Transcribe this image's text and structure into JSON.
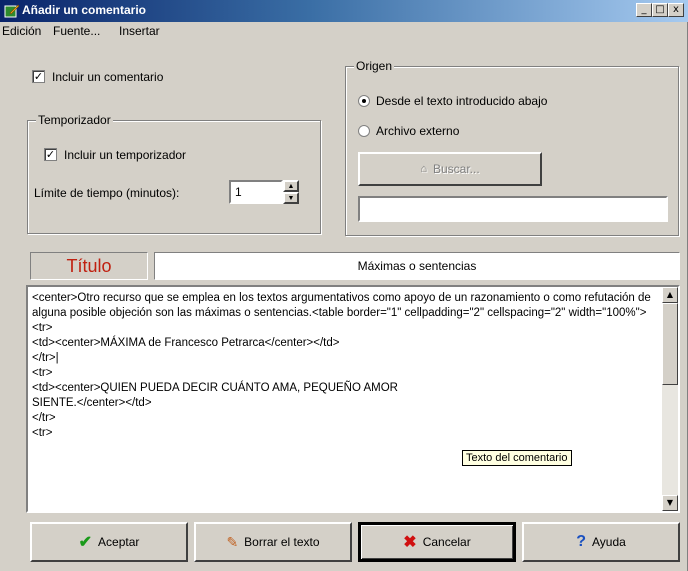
{
  "window": {
    "title": "Añadir un comentario",
    "min": "_",
    "max": "□",
    "close": "x"
  },
  "menu": [
    "Edición",
    "Fuente...",
    "Insertar"
  ],
  "include_comment": {
    "label": "Incluir un comentario",
    "checked": "✓"
  },
  "timer": {
    "group_label": "Temporizador",
    "include_label": "Incluir un temporizador",
    "checked": "✓",
    "limit_label": "Límite de tiempo (minutos):",
    "limit_value": "1"
  },
  "origin": {
    "group_label": "Origen",
    "option_text": "Desde el texto introducido abajo",
    "option_file": "Archivo externo",
    "browse_label": "Buscar...",
    "file_path": ""
  },
  "title_row": {
    "label": "Título",
    "value": "Máximas o sentencias"
  },
  "comment_text": "<center>Otro recurso que se emplea en los textos argumentativos como apoyo de un razonamiento o como refutación de alguna posible objeción son las máximas o sentencias.<table border=\"1\" cellpadding=\"2\" cellspacing=\"2\" width=\"100%\">\n<tr>\n<td><center>MÁXIMA de Francesco Petrarca</center></td>\n</tr>|\n<tr>\n<td><center>QUIEN PUEDA DECIR CUÁNTO AMA, PEQUEÑO AMOR\nSIENTE.</center></td>\n</tr>\n<tr>",
  "tooltip": "Texto del comentario",
  "buttons": {
    "accept": "Aceptar",
    "clear": "Borrar el texto",
    "cancel": "Cancelar",
    "help": "Ayuda"
  }
}
